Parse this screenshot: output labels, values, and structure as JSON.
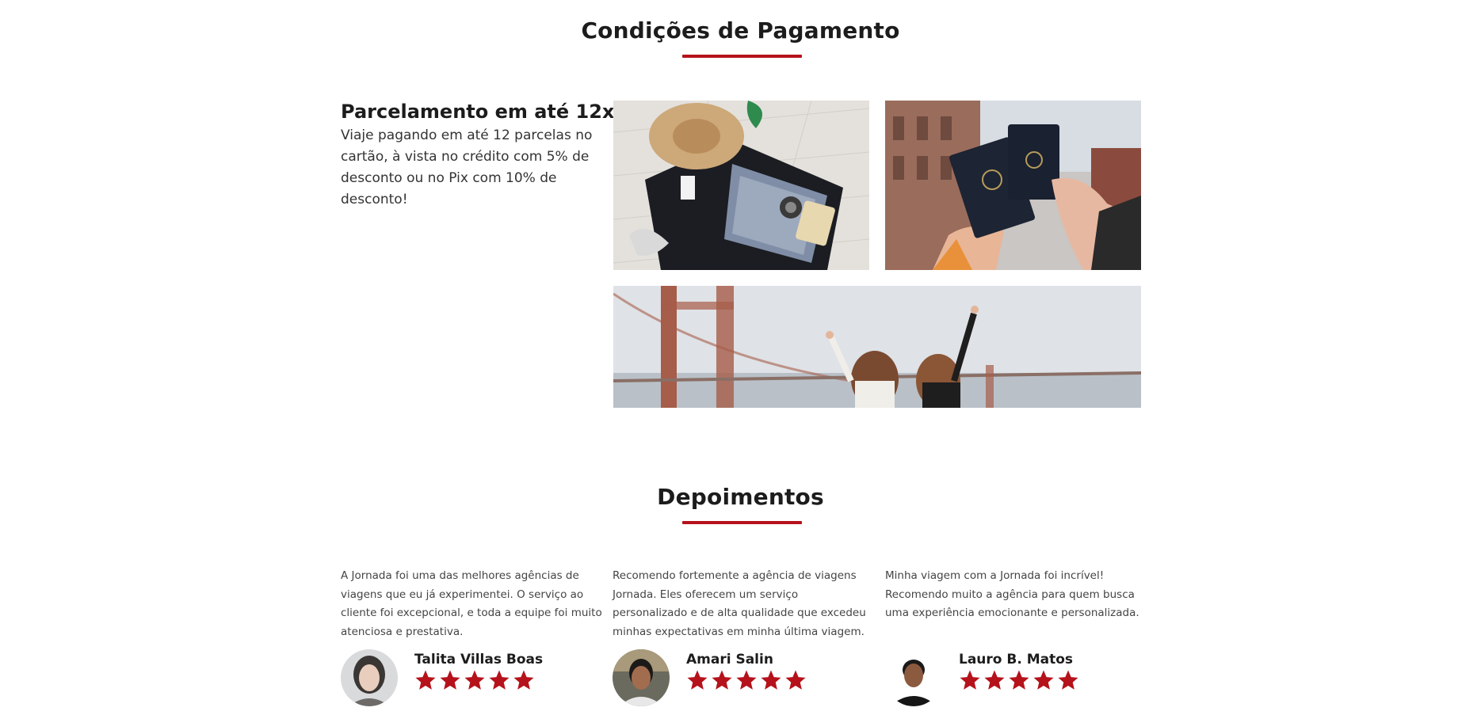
{
  "payment": {
    "section_title": "Condições de Pagamento",
    "heading": "Parcelamento em até 12x!",
    "text": "Viaje pagando em até 12 parcelas no cartão, à vista no crédito com 5% de desconto ou no Pix com 10% de desconto!",
    "accent_color": "#b5121b"
  },
  "testimonials": {
    "section_title": "Depoimentos",
    "items": [
      {
        "text": "A Jornada foi uma das melhores agências de viagens que eu já experimentei. O serviço ao cliente foi excepcional, e toda a equipe foi muito atenciosa e prestativa.",
        "name": "Talita Villas Boas",
        "rating": 5
      },
      {
        "text": "Recomendo fortemente a agência de viagens Jornada. Eles oferecem um serviço personalizado e de alta qualidade que excedeu minhas expectativas em minha última viagem.",
        "name": "Amari Salin",
        "rating": 5
      },
      {
        "text": "Minha viagem com a Jornada foi incrível! Recomendo muito a agência para quem busca uma experiência emocionante e personalizada.",
        "name": "Lauro B. Matos",
        "rating": 5
      }
    ],
    "star_color": "#b5121b"
  }
}
